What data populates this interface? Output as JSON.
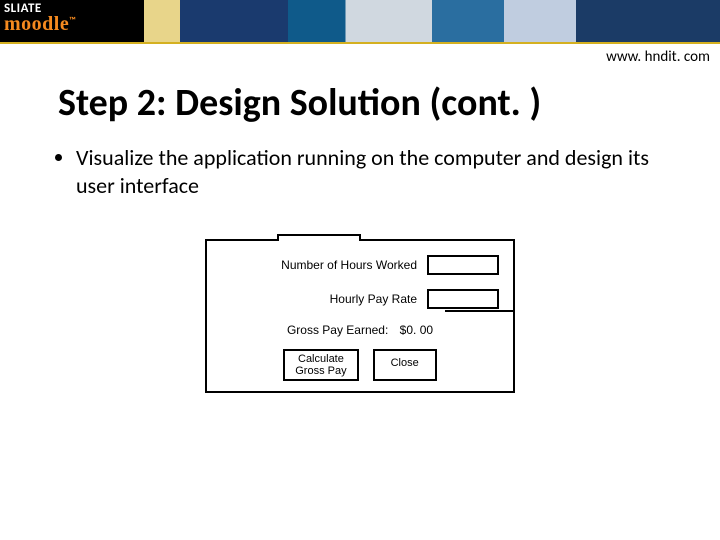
{
  "brand": {
    "sliate": "SLIATE",
    "moodle": "moodle",
    "tm": "™"
  },
  "url": "www. hndit. com",
  "title": "Step 2:  Design Solution (cont. )",
  "bullet": "Visualize the application running on the computer and design its user interface",
  "mock": {
    "hours_label": "Number of Hours Worked",
    "rate_label": "Hourly Pay Rate",
    "gross_label": "Gross Pay Earned:",
    "gross_value": "$0. 00",
    "calc_btn_l1": "Calculate",
    "calc_btn_l2": "Gross Pay",
    "close_btn": "Close"
  }
}
